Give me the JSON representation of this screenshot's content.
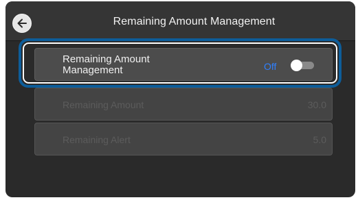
{
  "header": {
    "title": "Remaining Amount Management",
    "back_icon": "arrow-left-icon"
  },
  "settings": {
    "amount_management": {
      "label": "Remaining Amount\nManagement",
      "state_label": "Off",
      "enabled": false
    },
    "remaining_amount": {
      "label": "Remaining Amount",
      "value": "30.0"
    },
    "remaining_alert": {
      "label": "Remaining Alert",
      "value": "5.0"
    }
  },
  "colors": {
    "accent_off": "#2f80ff",
    "highlight": "#0d5d9a",
    "background": "#2a2a2a"
  }
}
